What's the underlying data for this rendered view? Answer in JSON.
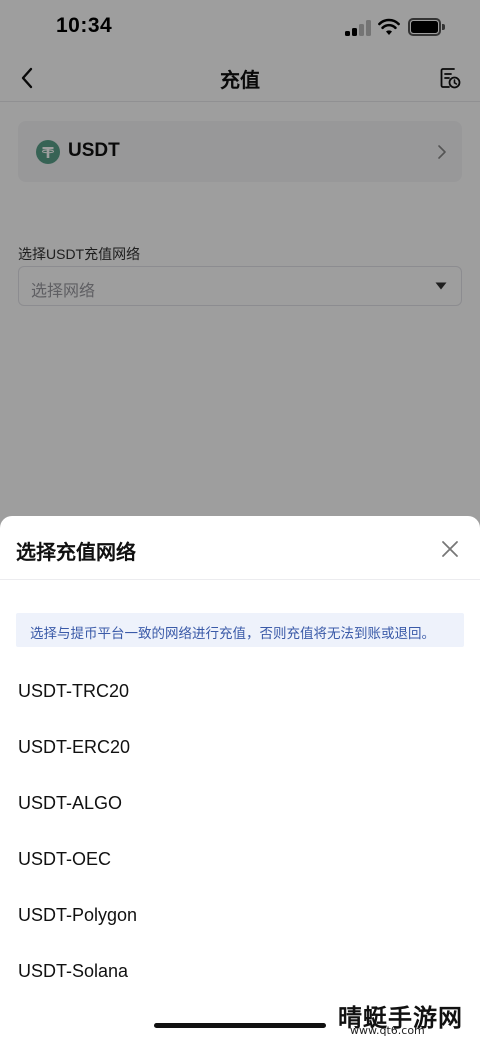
{
  "status_bar": {
    "time": "10:34"
  },
  "nav": {
    "title": "充值",
    "back_icon": "back-arrow-icon",
    "history_icon": "history-record-icon"
  },
  "coin": {
    "name": "USDT",
    "icon": "tether-icon",
    "icon_color": "#5aa08a"
  },
  "network": {
    "label": "选择USDT充值网络",
    "placeholder": "选择网络"
  },
  "sheet": {
    "title": "选择充值网络",
    "notice": "选择与提币平台一致的网络进行充值，否则充值将无法到账或退回。",
    "items": [
      {
        "label": "USDT-TRC20"
      },
      {
        "label": "USDT-ERC20"
      },
      {
        "label": "USDT-ALGO"
      },
      {
        "label": "USDT-OEC"
      },
      {
        "label": "USDT-Polygon"
      },
      {
        "label": "USDT-Solana"
      }
    ]
  },
  "watermark": {
    "main": "晴蜓手游网",
    "sub": "www.qt6.com"
  },
  "colors": {
    "notice_bg": "#eef2fb",
    "notice_text": "#3a5aa8",
    "overlay": "rgba(0,0,0,0.38)"
  }
}
